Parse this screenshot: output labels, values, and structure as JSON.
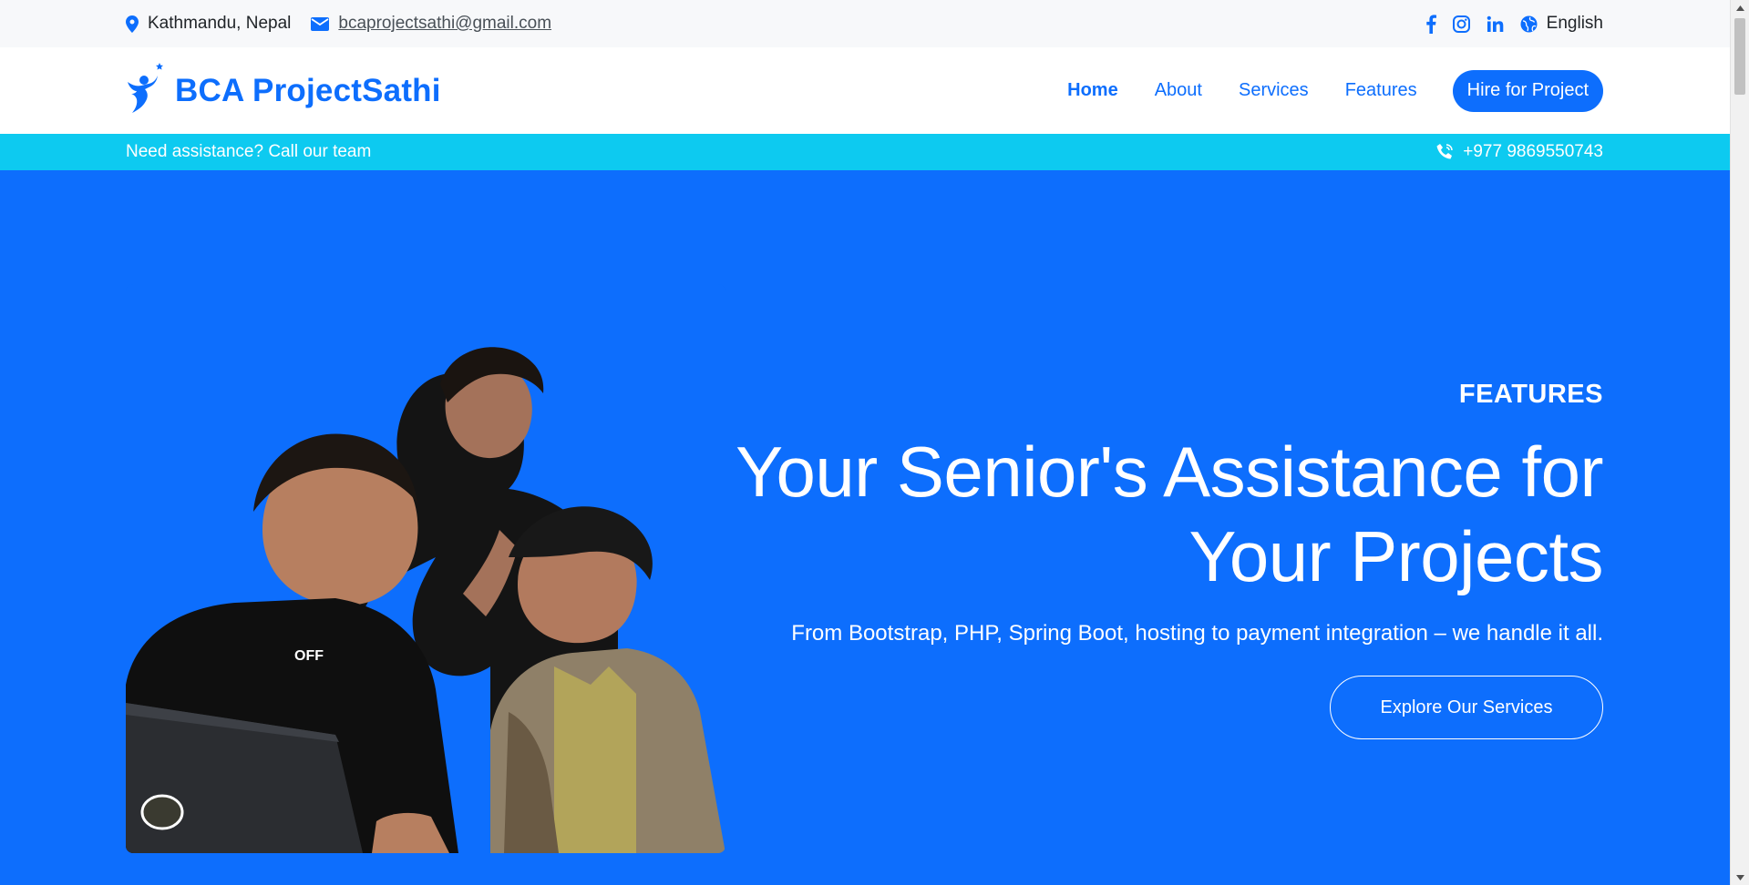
{
  "colors": {
    "primary": "#0d6efd",
    "info": "#0dcaf0",
    "white": "#ffffff"
  },
  "topbar": {
    "location": "Kathmandu, Nepal",
    "email": "bcaprojectsathi@gmail.com",
    "social_icons": [
      "facebook-icon",
      "instagram-icon",
      "linkedin-icon"
    ],
    "language": "English"
  },
  "navbar": {
    "brand": "BCA ProjectSathi",
    "links": [
      "Home",
      "About",
      "Services",
      "Features"
    ],
    "active": "Home",
    "cta": "Hire for Project"
  },
  "strip": {
    "text": "Need assistance? Call our team",
    "phone": "+977 9869550743"
  },
  "hero": {
    "eyebrow": "FEATURES",
    "headline_line1": "Your Senior's Assistance for",
    "headline_line2": "Your Projects",
    "lead": "From Bootstrap, PHP, Spring Boot, hosting to payment integration – we handle it all.",
    "button": "Explore Our Services",
    "image_shirt_text": "OFF"
  }
}
